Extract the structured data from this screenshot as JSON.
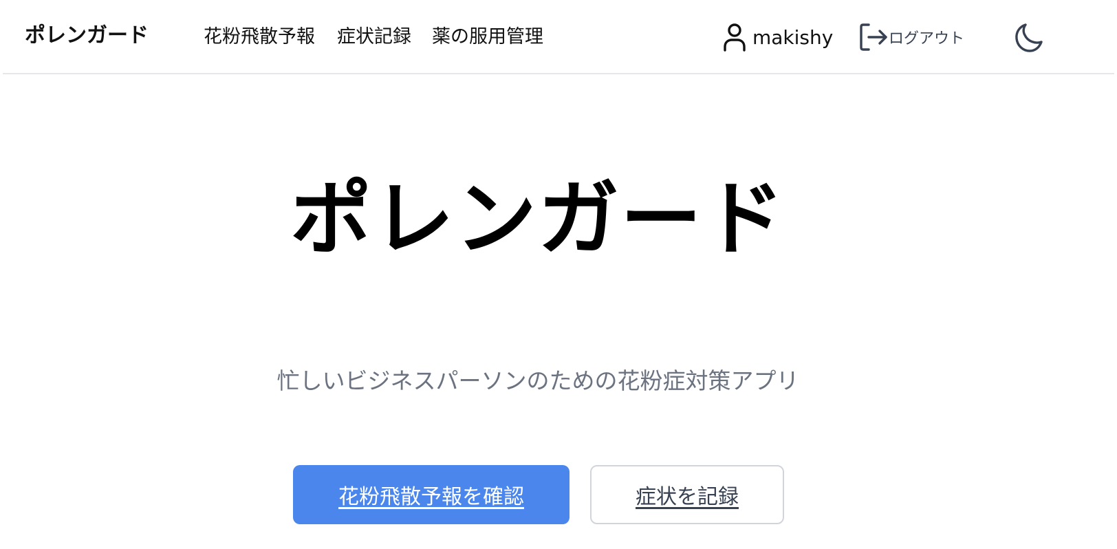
{
  "header": {
    "brand": "ポレンガード",
    "nav": {
      "forecast": "花粉飛散予報",
      "symptoms": "症状記録",
      "medication": "薬の服用管理"
    },
    "user": {
      "icon": "user-icon",
      "name": "makishy"
    },
    "logout": {
      "icon": "logout-icon",
      "label": "ログアウト"
    },
    "theme_toggle": {
      "icon": "moon-icon"
    }
  },
  "hero": {
    "title": "ポレンガード",
    "subtitle": "忙しいビジネスパーソンのための花粉症対策アプリ",
    "primary_button": "花粉飛散予報を確認",
    "secondary_button": "症状を記録"
  },
  "colors": {
    "primary": "#4a86ec",
    "subtitle": "#6b7280",
    "icon": "#374151",
    "border": "#e5e7eb"
  }
}
